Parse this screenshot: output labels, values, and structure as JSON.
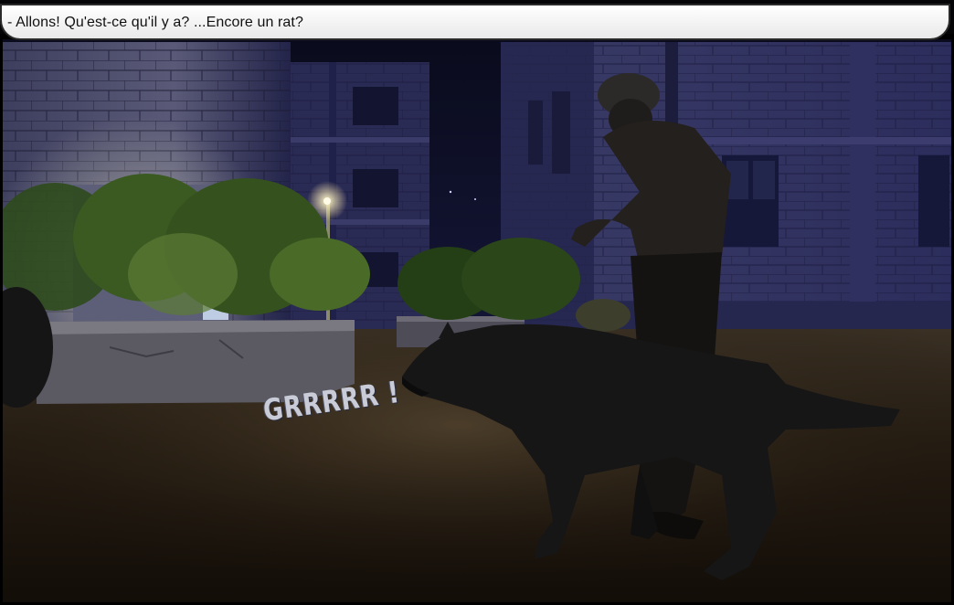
{
  "caption": {
    "text": "- Allons! Qu'est-ce qu'il y a? ...Encore un rat?"
  },
  "sound_effect": {
    "text": "GRRRRR !"
  },
  "scene": {
    "figures": [
      "soldier-figure",
      "wolf-dog-figure"
    ],
    "colors": {
      "night_sky": "#0d0f22",
      "building_wall": "#2c2d5a",
      "ground": "#2a2016",
      "foliage": "#2f4a1e",
      "lamp_glow": "#ffe9a8"
    }
  }
}
